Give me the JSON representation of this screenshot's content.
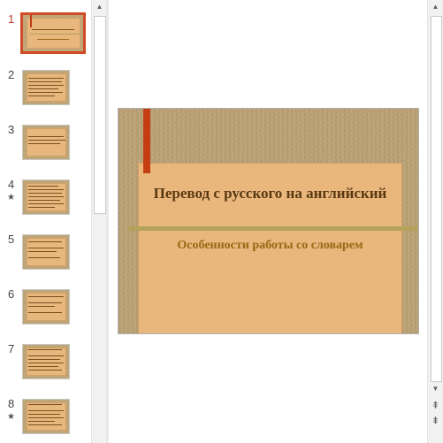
{
  "thumbnails": [
    {
      "number": "1",
      "star": ""
    },
    {
      "number": "2",
      "star": ""
    },
    {
      "number": "3",
      "star": ""
    },
    {
      "number": "4",
      "star": "★"
    },
    {
      "number": "5",
      "star": ""
    },
    {
      "number": "6",
      "star": ""
    },
    {
      "number": "7",
      "star": ""
    },
    {
      "number": "8",
      "star": "★"
    }
  ],
  "active_slide": "1",
  "slide": {
    "title": "Перевод с русского на английский",
    "subtitle": "Особенности работы со словарем"
  },
  "scrollbar": {
    "up_glyph": "▲",
    "down_glyph": "▼",
    "prev_slide_glyph": "⇞",
    "next_slide_glyph": "⇟"
  },
  "colors": {
    "accent_red": "#c53d12",
    "active_border": "#d04a26",
    "title_brown": "#5a3912",
    "subtitle_gold": "#946a13",
    "divider_olive": "#b3a35a"
  }
}
